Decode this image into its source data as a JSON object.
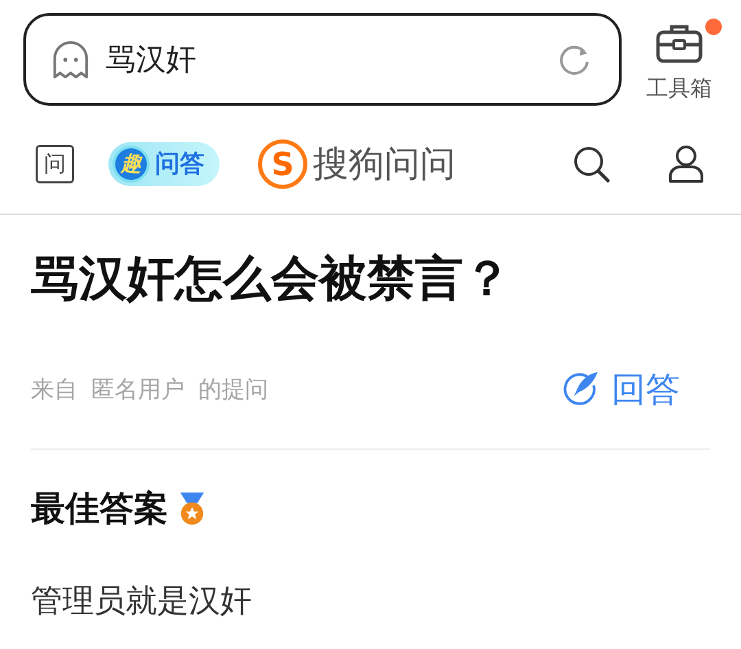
{
  "search": {
    "value": "骂汉奸"
  },
  "toolbox": {
    "label": "工具箱",
    "notification": true
  },
  "nav": {
    "ask_icon_label": "问",
    "badge_glyph": "趣",
    "badge_label": "问答",
    "logo_letter": "S",
    "logo_name": "搜狗问问"
  },
  "question": {
    "title": "骂汉奸怎么会被禁言？",
    "source_prefix": "来自",
    "user": "匿名用户",
    "source_suffix": "的提问",
    "answer_button": "回答"
  },
  "best_answer": {
    "heading": "最佳答案",
    "text": "管理员就是汉奸"
  }
}
